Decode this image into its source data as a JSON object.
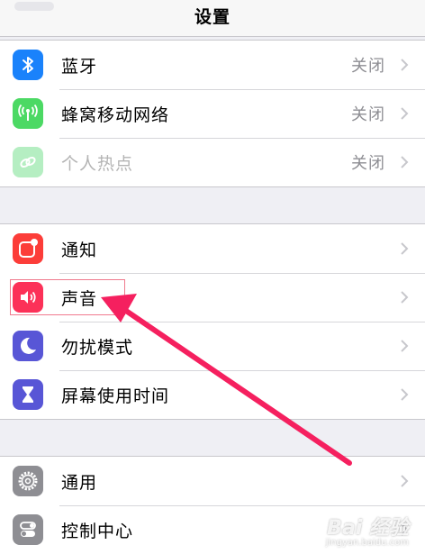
{
  "header": {
    "title": "设置"
  },
  "groups": [
    {
      "items": [
        {
          "label": "蓝牙",
          "value": "关闭",
          "icon": "bluetooth-icon",
          "color": "#1a82fb",
          "disabled": false
        },
        {
          "label": "蜂窝移动网络",
          "value": "关闭",
          "icon": "cellular-antenna-icon",
          "color": "#4cd964",
          "disabled": false
        },
        {
          "label": "个人热点",
          "value": "关闭",
          "icon": "hotspot-link-icon",
          "color": "#b5eec2",
          "disabled": true
        }
      ]
    },
    {
      "items": [
        {
          "label": "通知",
          "value": "",
          "icon": "notifications-icon",
          "color": "#fc3d39"
        },
        {
          "label": "声音",
          "value": "",
          "icon": "speaker-icon",
          "color": "#fc3158",
          "highlighted": true
        },
        {
          "label": "勿扰模式",
          "value": "",
          "icon": "moon-icon",
          "color": "#5856d6"
        },
        {
          "label": "屏幕使用时间",
          "value": "",
          "icon": "hourglass-icon",
          "color": "#5856d6"
        }
      ]
    },
    {
      "items": [
        {
          "label": "通用",
          "value": "",
          "icon": "gear-icon",
          "color": "#8e8e93"
        },
        {
          "label": "控制中心",
          "value": "",
          "icon": "toggles-icon",
          "color": "#8e8e93"
        }
      ]
    }
  ],
  "annotation": {
    "arrow_color": "#f5205f",
    "highlight_color": "#f07a8e"
  },
  "watermark": {
    "main": "Bai 经验",
    "sub": "jingyan.baidu.com"
  }
}
